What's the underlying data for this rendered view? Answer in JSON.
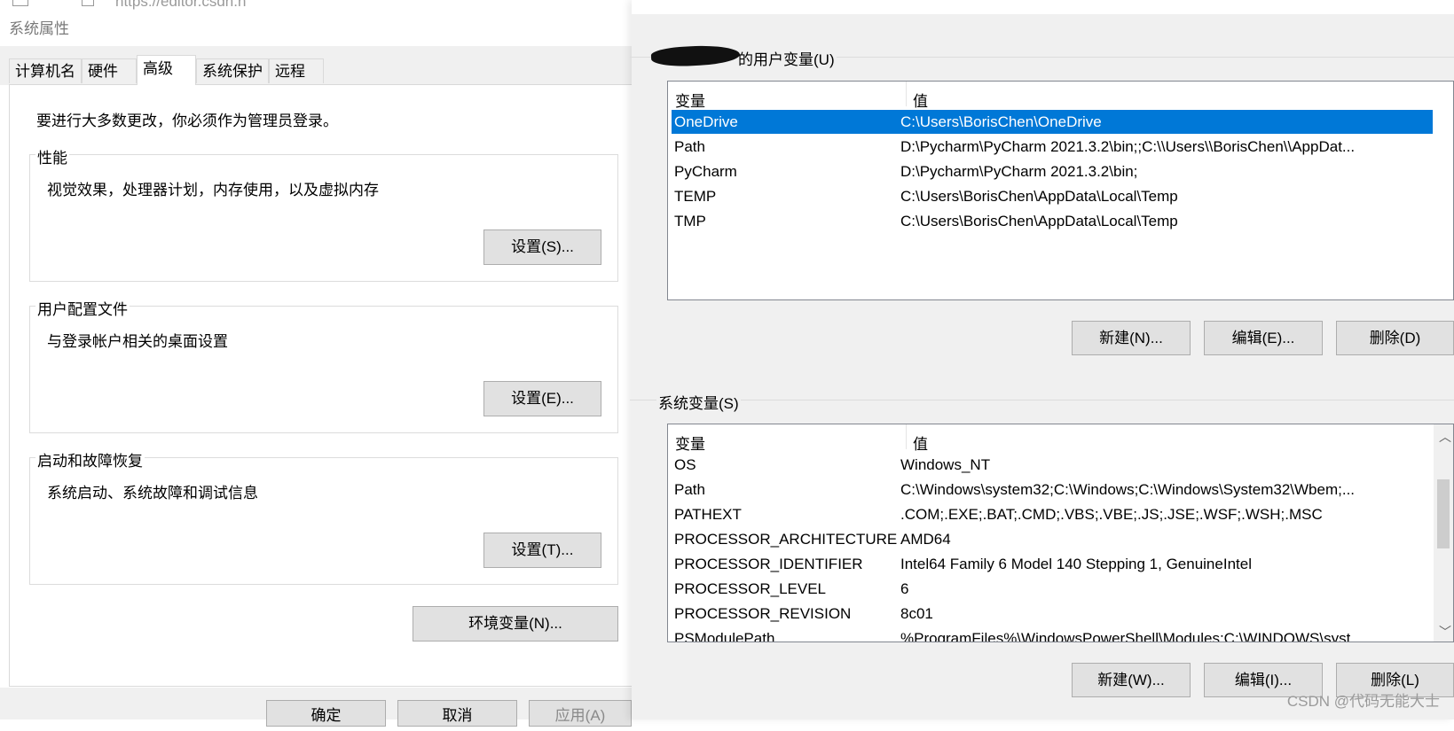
{
  "left_dialog": {
    "title": "系统属性",
    "url_peek": "https://editor.csdn.n",
    "tabs": [
      {
        "label": "计算机名"
      },
      {
        "label": "硬件"
      },
      {
        "label": "高级",
        "active": true
      },
      {
        "label": "系统保护"
      },
      {
        "label": "远程"
      }
    ],
    "admin_note": "要进行大多数更改，你必须作为管理员登录。",
    "performance": {
      "title": "性能",
      "description": "视觉效果，处理器计划，内存使用，以及虚拟内存",
      "button": "设置(S)..."
    },
    "user_profiles": {
      "title": "用户配置文件",
      "description": "与登录帐户相关的桌面设置",
      "button": "设置(E)..."
    },
    "startup_recovery": {
      "title": "启动和故障恢复",
      "description": "系统启动、系统故障和调试信息",
      "button": "设置(T)..."
    },
    "env_button": "环境变量(N)...",
    "footer_buttons": {
      "ok": "确定",
      "cancel": "取消",
      "apply": "应用(A)"
    }
  },
  "right_dialog": {
    "user_vars_label": "的用户变量(U)",
    "columns": {
      "name": "变量",
      "value": "值"
    },
    "user_vars": [
      {
        "name": "OneDrive",
        "value": "C:\\Users\\BorisChen\\OneDrive",
        "selected": true
      },
      {
        "name": "Path",
        "value": "D:\\Pycharm\\PyCharm 2021.3.2\\bin;;C:\\\\Users\\\\BorisChen\\\\AppDat..."
      },
      {
        "name": "PyCharm",
        "value": "D:\\Pycharm\\PyCharm 2021.3.2\\bin;"
      },
      {
        "name": "TEMP",
        "value": "C:\\Users\\BorisChen\\AppData\\Local\\Temp"
      },
      {
        "name": "TMP",
        "value": "C:\\Users\\BorisChen\\AppData\\Local\\Temp"
      }
    ],
    "user_buttons": {
      "new": "新建(N)...",
      "edit": "编辑(E)...",
      "delete": "删除(D)"
    },
    "system_vars_label": "系统变量(S)",
    "system_vars": [
      {
        "name": "OS",
        "value": "Windows_NT"
      },
      {
        "name": "Path",
        "value": "C:\\Windows\\system32;C:\\Windows;C:\\Windows\\System32\\Wbem;..."
      },
      {
        "name": "PATHEXT",
        "value": ".COM;.EXE;.BAT;.CMD;.VBS;.VBE;.JS;.JSE;.WSF;.WSH;.MSC"
      },
      {
        "name": "PROCESSOR_ARCHITECTURE",
        "value": "AMD64"
      },
      {
        "name": "PROCESSOR_IDENTIFIER",
        "value": "Intel64 Family 6 Model 140 Stepping 1, GenuineIntel"
      },
      {
        "name": "PROCESSOR_LEVEL",
        "value": "6"
      },
      {
        "name": "PROCESSOR_REVISION",
        "value": "8c01"
      },
      {
        "name": "PSModulePath",
        "value": "%ProgramFiles%\\WindowsPowerShell\\Modules;C:\\WINDOWS\\syst"
      }
    ],
    "system_buttons": {
      "new": "新建(W)...",
      "edit": "编辑(I)...",
      "delete": "删除(L)"
    }
  },
  "watermark": "CSDN @代码无能大士",
  "colors": {
    "selection": "#0078d7",
    "dialog_bg": "#f0f0f0",
    "button_bg": "#e1e1e1"
  }
}
